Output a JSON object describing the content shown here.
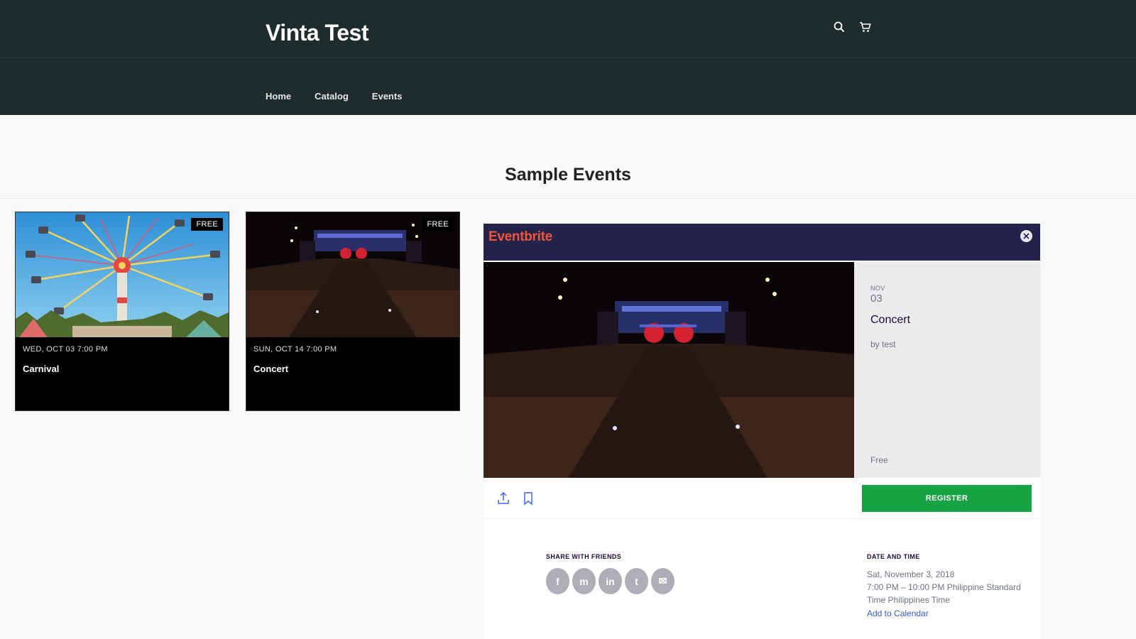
{
  "header": {
    "store_name": "Vinta Test",
    "nav": [
      {
        "label": "Home"
      },
      {
        "label": "Catalog"
      },
      {
        "label": "Events"
      }
    ]
  },
  "main": {
    "title": "Sample Events",
    "events": [
      {
        "badge": "FREE",
        "date": "WED, OCT 03 7:00 PM",
        "name": "Carnival"
      },
      {
        "badge": "FREE",
        "date": "SUN, OCT 14 7:00 PM",
        "name": "Concert"
      }
    ]
  },
  "modal": {
    "brand": "Eventbrite",
    "month": "NOV",
    "day": "03",
    "title": "Concert",
    "organizer": "by test",
    "price": "Free",
    "register_label": "REGISTER",
    "share_label": "SHARE WITH FRIENDS",
    "share_buttons": [
      {
        "icon": "facebook-icon",
        "glyph": "f"
      },
      {
        "icon": "messenger-icon",
        "glyph": "m"
      },
      {
        "icon": "linkedin-icon",
        "glyph": "in"
      },
      {
        "icon": "twitter-icon",
        "glyph": "t"
      },
      {
        "icon": "email-icon",
        "glyph": "✉"
      }
    ],
    "date_time_label": "DATE AND TIME",
    "date_line": "Sat, November 3, 2018",
    "time_line1": "7:00 PM – 10:00 PM Philippine Standard",
    "time_line2": "Time Philippines Time",
    "add_calendar": "Add to Calendar"
  },
  "colors": {
    "header_bg": "#1f2c2c",
    "modal_header_bg": "#22224a",
    "eventbrite_orange": "#f05537",
    "register_green": "#16a343",
    "link_blue": "#3659e3"
  }
}
